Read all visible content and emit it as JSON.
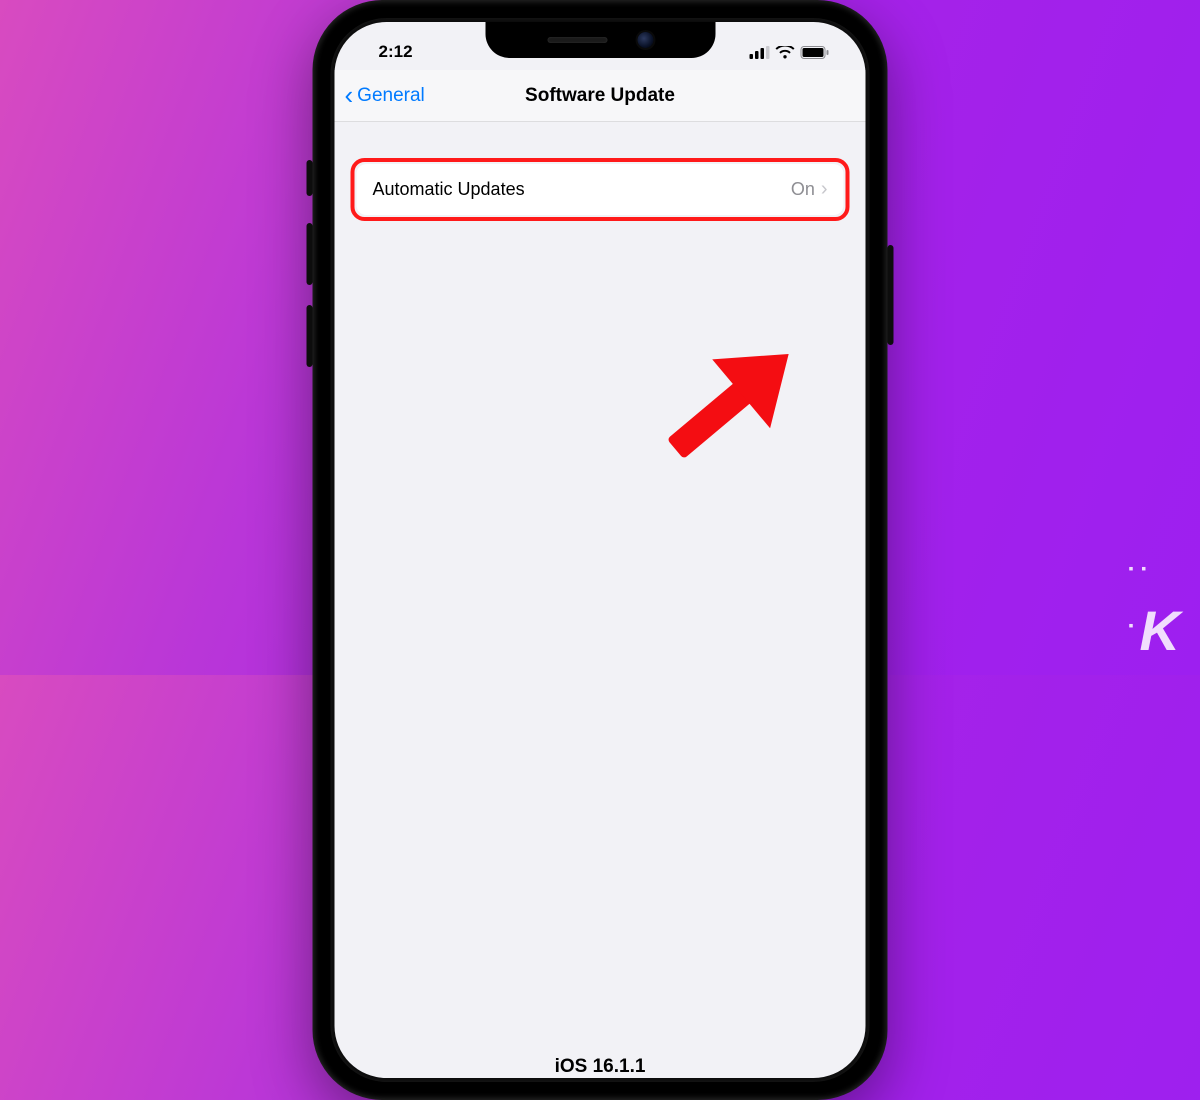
{
  "status": {
    "time": "2:12"
  },
  "nav": {
    "back_label": "General",
    "title": "Software Update"
  },
  "cells": {
    "auto_updates_label": "Automatic Updates",
    "auto_updates_value": "On"
  },
  "footer": {
    "version": "iOS 16.1.1"
  },
  "watermark": {
    "letter": "K"
  },
  "colors": {
    "highlight": "#ff1a1a",
    "link": "#007aff"
  }
}
